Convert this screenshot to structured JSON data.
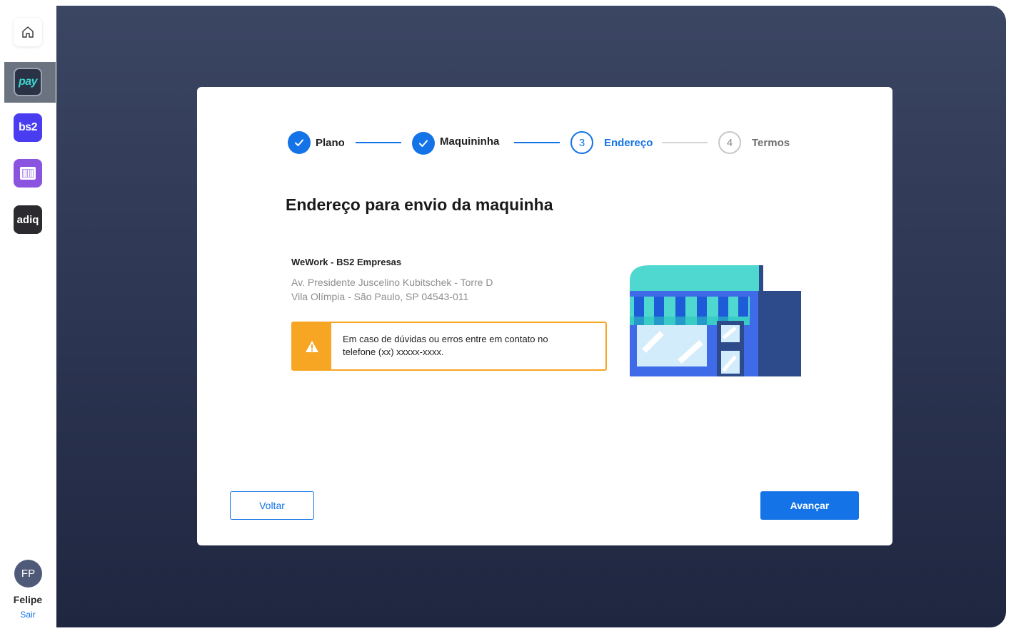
{
  "sidebar": {
    "apps": [
      {
        "name": "home",
        "icon": "home-icon"
      },
      {
        "name": "pay",
        "label": "pay",
        "accent": "#3fd6cf"
      },
      {
        "name": "bs2",
        "label": "bs2",
        "accent": "#4a3cf0"
      },
      {
        "name": "boleto",
        "icon": "barcode-icon",
        "accent": "#8a53e0"
      },
      {
        "name": "adiq",
        "label": "adiq",
        "accent": "#2b2b2f"
      }
    ],
    "user": {
      "initials": "FP",
      "name": "Felipe",
      "logout": "Sair"
    }
  },
  "stepper": {
    "steps": [
      {
        "label": "Plano",
        "state": "done"
      },
      {
        "label": "Maquininha",
        "state": "done"
      },
      {
        "number": "3",
        "label": "Endereço",
        "state": "active"
      },
      {
        "number": "4",
        "label": "Termos",
        "state": "todo"
      }
    ]
  },
  "page": {
    "title": "Endereço para envio da maquinha"
  },
  "address": {
    "name": "WeWork - BS2 Empresas",
    "line1": "Av. Presidente Juscelino Kubitschek -  Torre D",
    "line2": "Vila Olímpia - São Paulo, SP 04543-011"
  },
  "alert": {
    "icon": "warning-icon",
    "text_line1": "Em caso de dúvidas ou erros entre em contato no",
    "text_line2": "telefone (xx) xxxxx-xxxx."
  },
  "actions": {
    "back": "Voltar",
    "next": "Avançar"
  },
  "colors": {
    "primary": "#1473e6",
    "warning": "#f6a623",
    "background_dark": "#2b3450"
  }
}
